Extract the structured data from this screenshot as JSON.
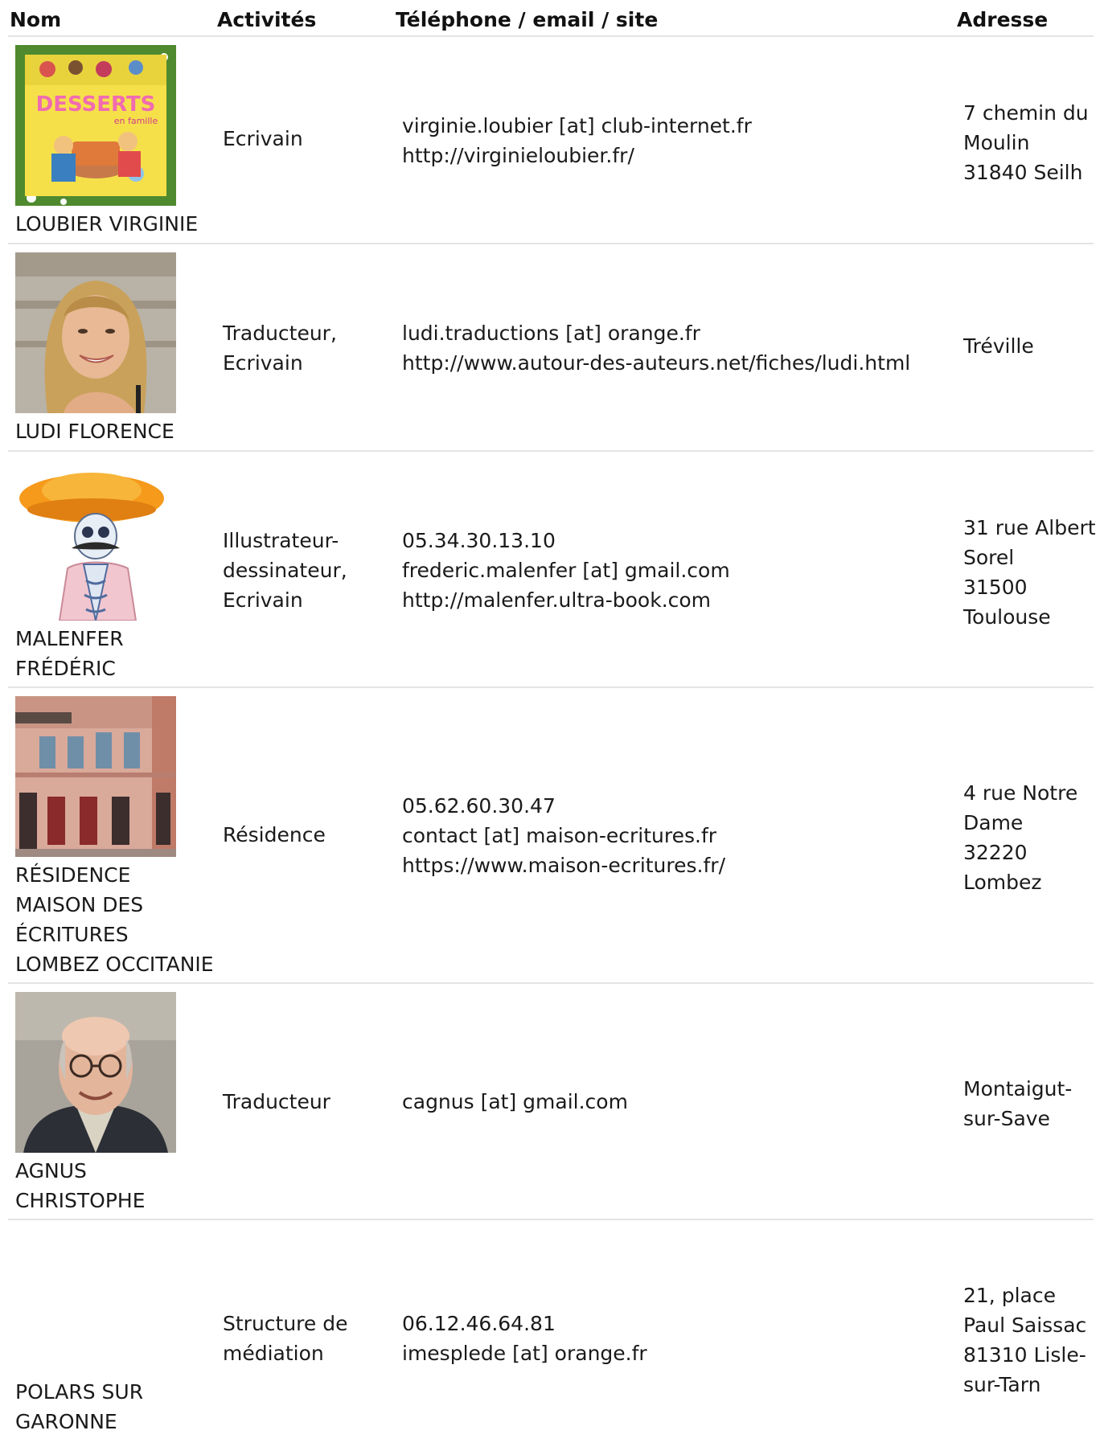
{
  "header": {
    "nom": "Nom",
    "activites": "Activités",
    "contact": "Téléphone / email / site",
    "adresse": "Adresse"
  },
  "rows": [
    {
      "name_lines": [
        "LOUBIER VIRGINIE"
      ],
      "photo_icon": "book-cover-desserts-image",
      "photo_text": [
        "DESSERTS",
        "en famille"
      ],
      "activity_lines": [
        "Ecrivain"
      ],
      "contact_lines": [
        "virginie.loubier [at] club-internet.fr",
        "http://virginieloubier.fr/"
      ],
      "address_lines": [
        "7 chemin du",
        "Moulin",
        "31840 Seilh"
      ]
    },
    {
      "name_lines": [
        "LUDI FLORENCE"
      ],
      "photo_icon": "portrait-woman-image",
      "activity_lines": [
        "Traducteur,",
        "Ecrivain"
      ],
      "contact_lines": [
        "ludi.traductions [at] orange.fr",
        "http://www.autour-des-auteurs.net/fiches/ludi.html"
      ],
      "address_lines": [
        "Tréville"
      ]
    },
    {
      "name_lines": [
        "MALENFER",
        "FRÉDÉRIC"
      ],
      "photo_icon": "skeleton-sombrero-illustration",
      "activity_lines": [
        "Illustrateur-",
        "dessinateur,",
        "Ecrivain"
      ],
      "contact_lines": [
        "05.34.30.13.10",
        "frederic.malenfer [at] gmail.com",
        "http://malenfer.ultra-book.com"
      ],
      "address_lines": [
        "31 rue Albert",
        "Sorel",
        "31500",
        "Toulouse"
      ]
    },
    {
      "name_lines": [
        "RÉSIDENCE",
        "MAISON DES",
        "ÉCRITURES",
        "LOMBEZ OCCITANIE"
      ],
      "photo_icon": "building-facade-image",
      "activity_lines": [
        "Résidence"
      ],
      "contact_lines": [
        "05.62.60.30.47",
        "contact [at] maison-ecritures.fr",
        "https://www.maison-ecritures.fr/"
      ],
      "address_lines": [
        "4 rue Notre",
        "Dame",
        "32220",
        "Lombez"
      ]
    },
    {
      "name_lines": [
        "AGNUS",
        "CHRISTOPHE"
      ],
      "photo_icon": "portrait-man-glasses-image",
      "activity_lines": [
        "Traducteur"
      ],
      "contact_lines": [
        "cagnus [at] gmail.com"
      ],
      "address_lines": [
        "Montaigut-",
        "sur-Save"
      ]
    },
    {
      "name_lines": [
        "POLARS SUR",
        "GARONNE"
      ],
      "photo_icon": "",
      "activity_lines": [
        "Structure de",
        "médiation"
      ],
      "contact_lines": [
        "06.12.46.64.81",
        "imesplede [at] orange.fr"
      ],
      "address_lines": [
        "21, place",
        "Paul Saissac",
        "81310 Lisle-",
        "sur-Tarn"
      ]
    }
  ],
  "colors": {
    "text": "#1a1a1a",
    "divider": "#e4e4e4",
    "book_yellow": "#f5e04a",
    "book_title_pink": "#f06bb0",
    "sombrero_orange": "#f59a1b"
  }
}
